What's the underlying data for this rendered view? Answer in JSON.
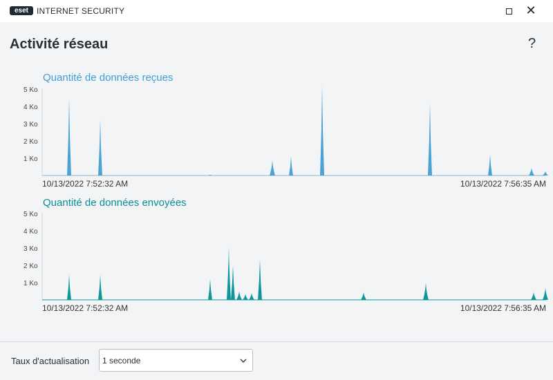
{
  "window": {
    "logo_text": "eset",
    "title": "INTERNET SECURITY",
    "help": "?"
  },
  "page": {
    "title": "Activité réseau"
  },
  "colors": {
    "received": "#4aa3d4",
    "sent": "#0e969b",
    "received_title": "#3d9fd3",
    "sent_title": "#0b8e92"
  },
  "charts": [
    {
      "title": "Quantité de données reçues",
      "start_time": "10/13/2022 7:52:32 AM",
      "end_time": "10/13/2022 7:56:35 AM"
    },
    {
      "title": "Quantité de données envoyées",
      "start_time": "10/13/2022 7:52:32 AM",
      "end_time": "10/13/2022 7:56:35 AM"
    }
  ],
  "chart_data": [
    {
      "type": "area",
      "title": "Quantité de données reçues",
      "ylim": [
        0,
        5
      ],
      "ytick_labels": [
        "5 Ko",
        "4 Ko",
        "3 Ko",
        "2 Ko",
        "1 Ko"
      ],
      "yticks": [
        5,
        4,
        3,
        2,
        1
      ],
      "x_range_seconds": [
        0,
        243
      ],
      "peaks": [
        {
          "t": 13,
          "v": 4.5
        },
        {
          "t": 28,
          "v": 3.25
        },
        {
          "t": 81,
          "v": 0.05
        },
        {
          "t": 111,
          "v": 0.9
        },
        {
          "t": 120,
          "v": 1.1
        },
        {
          "t": 135,
          "v": 5.3
        },
        {
          "t": 187,
          "v": 4.2
        },
        {
          "t": 216,
          "v": 1.2
        },
        {
          "t": 236,
          "v": 0.45
        },
        {
          "t": 243,
          "v": 0.25
        }
      ]
    },
    {
      "type": "area",
      "title": "Quantité de données envoyées",
      "ylim": [
        0,
        5
      ],
      "ytick_labels": [
        "5 Ko",
        "4 Ko",
        "3 Ko",
        "2 Ko",
        "1 Ko"
      ],
      "yticks": [
        5,
        4,
        3,
        2,
        1
      ],
      "x_range_seconds": [
        0,
        243
      ],
      "peaks": [
        {
          "t": 13,
          "v": 1.45
        },
        {
          "t": 28,
          "v": 1.45
        },
        {
          "t": 81,
          "v": 1.2
        },
        {
          "t": 90,
          "v": 3.1
        },
        {
          "t": 92,
          "v": 2.0
        },
        {
          "t": 95,
          "v": 0.5
        },
        {
          "t": 98,
          "v": 0.35
        },
        {
          "t": 101,
          "v": 0.4
        },
        {
          "t": 105,
          "v": 2.4
        },
        {
          "t": 155,
          "v": 0.45
        },
        {
          "t": 185,
          "v": 1.0
        },
        {
          "t": 237,
          "v": 0.45
        },
        {
          "t": 243,
          "v": 0.7
        }
      ]
    }
  ],
  "footer": {
    "refresh_label": "Taux d'actualisation",
    "refresh_value": "1 seconde"
  }
}
